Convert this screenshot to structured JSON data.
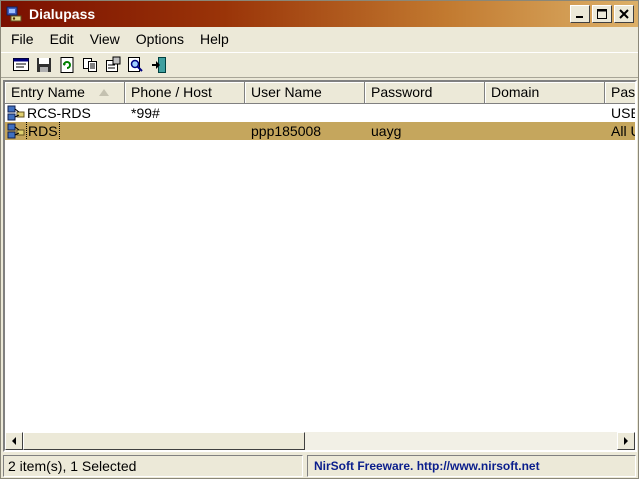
{
  "window": {
    "title": "Dialupass",
    "controls": [
      "minimize",
      "maximize",
      "close"
    ]
  },
  "menu": {
    "items": [
      "File",
      "Edit",
      "View",
      "Options",
      "Help"
    ]
  },
  "toolbar": {
    "tools": [
      "properties-icon",
      "save-icon",
      "refresh-icon",
      "copy-icon",
      "html-report-icon",
      "find-icon",
      "exit-icon"
    ]
  },
  "listview": {
    "columns": [
      "Entry Name",
      "Phone / Host",
      "User Name",
      "Password",
      "Domain",
      "Pas"
    ],
    "sorted_column": "Entry Name",
    "rows": [
      {
        "entry": "RCS-RDS",
        "phone": "*99#",
        "user": "",
        "password": "",
        "domain": "",
        "pas": "USE",
        "selected": false
      },
      {
        "entry": "RDS",
        "phone": "",
        "user": "ppp185008",
        "password": "uayg",
        "domain": "",
        "pas": "All U",
        "selected": true
      }
    ]
  },
  "statusbar": {
    "left": "2 item(s), 1 Selected",
    "right": "NirSoft Freeware.  http://www.nirsoft.net"
  },
  "colors": {
    "title_start": "#7a0f00",
    "title_end": "#dcb068",
    "selection": "#c5a65d",
    "link": "#0a1e8c"
  }
}
